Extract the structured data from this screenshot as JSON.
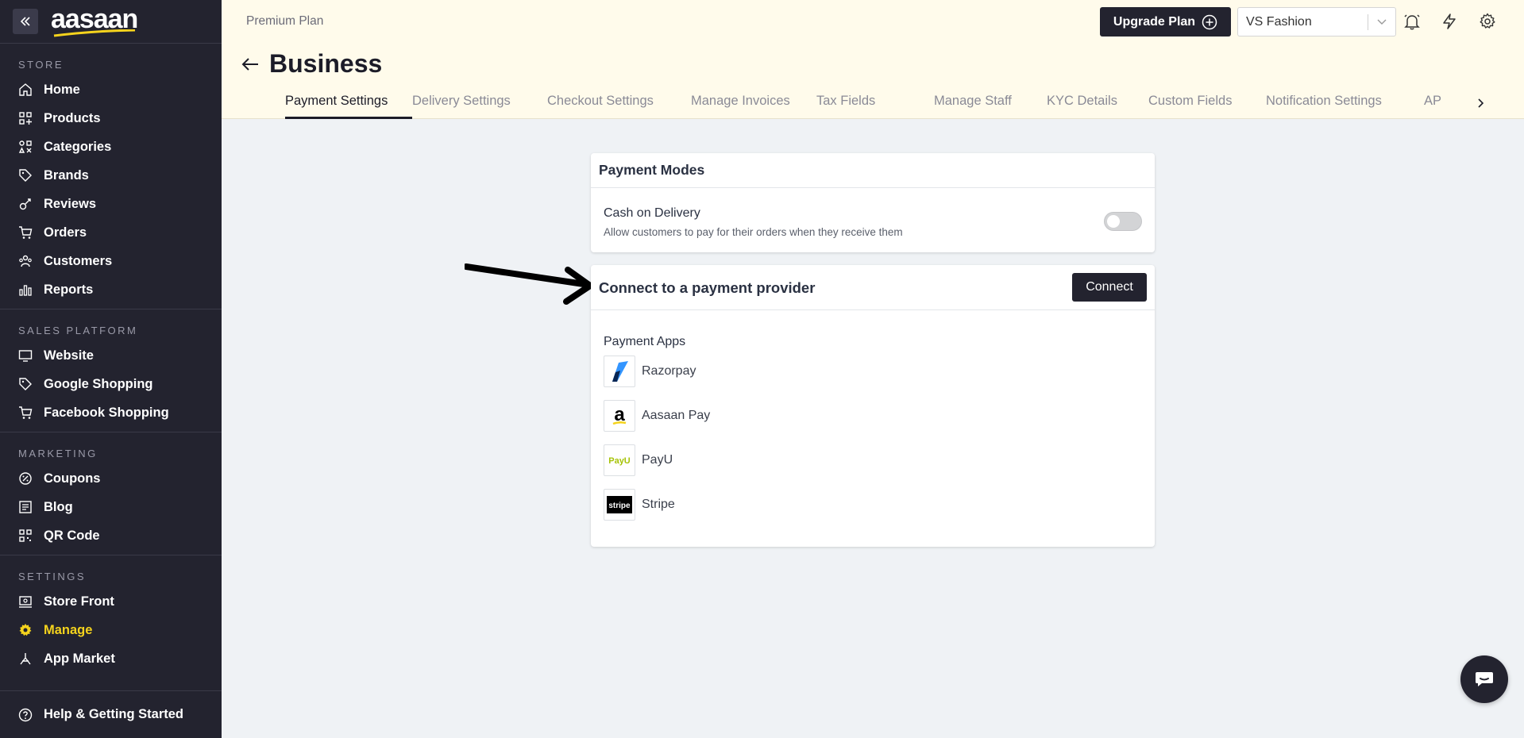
{
  "brand": {
    "logo_text": "aasaan"
  },
  "sidebar": {
    "sections": [
      {
        "title": "STORE",
        "items": [
          {
            "label": "Home",
            "icon": "home-icon"
          },
          {
            "label": "Products",
            "icon": "grid-plus-icon"
          },
          {
            "label": "Categories",
            "icon": "categories-icon"
          },
          {
            "label": "Brands",
            "icon": "tag-icon"
          },
          {
            "label": "Reviews",
            "icon": "reviews-icon"
          },
          {
            "label": "Orders",
            "icon": "cart-icon"
          },
          {
            "label": "Customers",
            "icon": "users-icon"
          },
          {
            "label": "Reports",
            "icon": "bar-chart-icon"
          }
        ]
      },
      {
        "title": "SALES PLATFORM",
        "items": [
          {
            "label": "Website",
            "icon": "monitor-icon"
          },
          {
            "label": "Google Shopping",
            "icon": "tag-icon"
          },
          {
            "label": "Facebook Shopping",
            "icon": "cart-icon"
          }
        ]
      },
      {
        "title": "MARKETING",
        "items": [
          {
            "label": "Coupons",
            "icon": "coupon-icon"
          },
          {
            "label": "Blog",
            "icon": "blog-icon"
          },
          {
            "label": "QR Code",
            "icon": "qr-code-icon"
          }
        ]
      },
      {
        "title": "SETTINGS",
        "items": [
          {
            "label": "Store Front",
            "icon": "storefront-icon"
          },
          {
            "label": "Manage",
            "icon": "gear-icon",
            "active": true
          },
          {
            "label": "App Market",
            "icon": "app-market-icon"
          }
        ]
      }
    ],
    "help_label": "Help & Getting Started"
  },
  "header": {
    "plan": "Premium Plan",
    "upgrade_label": "Upgrade Plan",
    "store_name": "VS Fashion",
    "page_title": "Business",
    "tabs": [
      "Payment Settings",
      "Delivery Settings",
      "Checkout Settings",
      "Manage Invoices",
      "Tax Fields",
      "Manage Staff",
      "KYC Details",
      "Custom Fields",
      "Notification Settings",
      "AP"
    ],
    "active_tab": 0
  },
  "payment_modes": {
    "title": "Payment Modes",
    "cod_title": "Cash on Delivery",
    "cod_description": "Allow customers to pay for their orders when they receive them",
    "cod_enabled": false
  },
  "provider": {
    "title": "Connect to a payment provider",
    "connect_label": "Connect",
    "apps_title": "Payment Apps",
    "apps": [
      {
        "name": "Razorpay"
      },
      {
        "name": "Aasaan Pay"
      },
      {
        "name": "PayU"
      },
      {
        "name": "Stripe"
      }
    ]
  },
  "colors": {
    "sidebar_bg": "#23232f",
    "header_bg": "#fffbeb",
    "active_accent": "#f5d31d",
    "content_bg": "#eff2f5"
  }
}
